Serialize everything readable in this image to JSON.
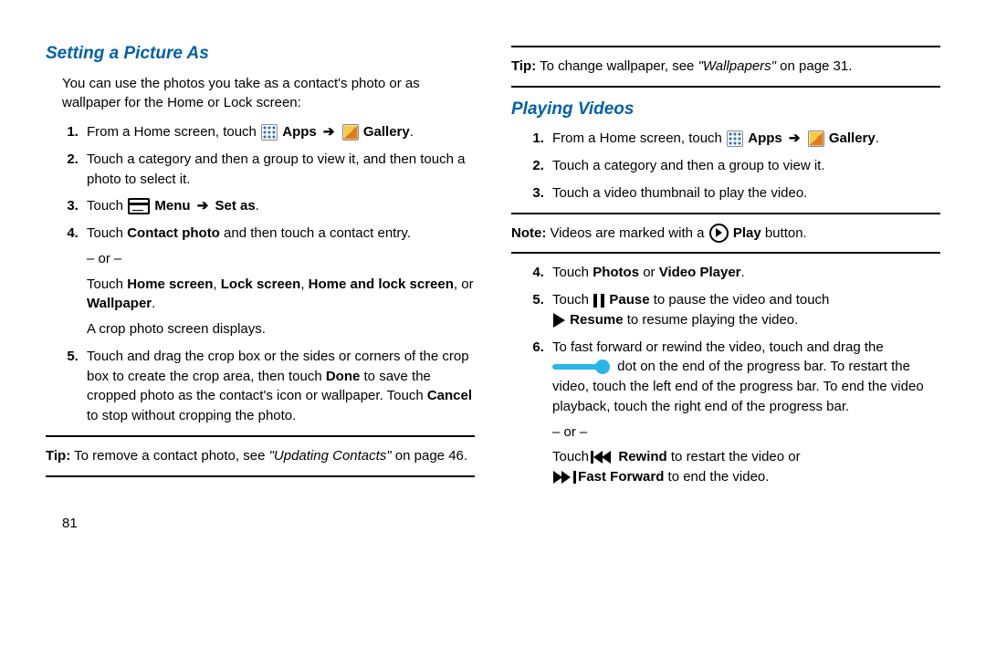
{
  "left": {
    "heading": "Setting a Picture As",
    "intro": "You can use the photos you take as a contact's photo or as wallpaper for the Home or Lock screen:",
    "step1_a": "From a Home screen, touch ",
    "apps_label": "Apps",
    "gallery_label": "Gallery",
    "step2": "Touch a category and then a group to view it, and then touch a photo to select it.",
    "step3_a": "Touch ",
    "step3_b": "Menu",
    "step3_c": "Set as",
    "step4_a": "Touch ",
    "step4_b": "Contact photo",
    "step4_c": " and then touch a contact entry.",
    "or": "– or –",
    "step4_d": "Touch ",
    "step4_e": "Home screen",
    "step4_f": "Lock screen",
    "step4_g": "Home and lock screen",
    "step4_h": "Wallpaper",
    "step4_i": "A crop photo screen displays.",
    "step5_a": "Touch and drag the crop box or the sides or corners of the crop box to create the crop area, then touch ",
    "step5_b": "Done",
    "step5_c": " to save the cropped photo as the contact's icon or wallpaper. Touch ",
    "step5_d": "Cancel",
    "step5_e": " to stop without cropping the photo.",
    "tip_a": "Tip:",
    "tip_b": " To remove a contact photo, see ",
    "tip_c": "\"Updating Contacts\"",
    "tip_d": " on page 46.",
    "page_num": "81"
  },
  "right": {
    "tip_a": "Tip:",
    "tip_b": " To change wallpaper, see ",
    "tip_c": "\"Wallpapers\"",
    "tip_d": " on page 31.",
    "heading": "Playing Videos",
    "step1_a": "From a Home screen, touch ",
    "apps_label": "Apps",
    "gallery_label": "Gallery",
    "step2": "Touch a category and then a group to view it.",
    "step3": "Touch a video thumbnail to play the video.",
    "note_a": "Note:",
    "note_b": " Videos are marked with a ",
    "note_c": "Play",
    "note_d": " button.",
    "step4_a": "Touch ",
    "step4_b": "Photos",
    "step4_c": " or ",
    "step4_d": "Video Player",
    "step5_a": "Touch ",
    "step5_b": "Pause",
    "step5_c": " to pause the video and touch ",
    "step5_d": "Resume",
    "step5_e": " to resume playing the video.",
    "step6_a": "To fast forward or rewind the video, touch and drag the ",
    "step6_b": " dot on the end of the progress bar. To restart the video, touch the left end of the progress bar. To end the video playback, touch the right end of the progress bar.",
    "or": "– or –",
    "step6_c": "Touch ",
    "step6_d": "Rewind",
    "step6_e": " to restart the video or ",
    "step6_f": "Fast Forward",
    "step6_g": " to end the video."
  }
}
